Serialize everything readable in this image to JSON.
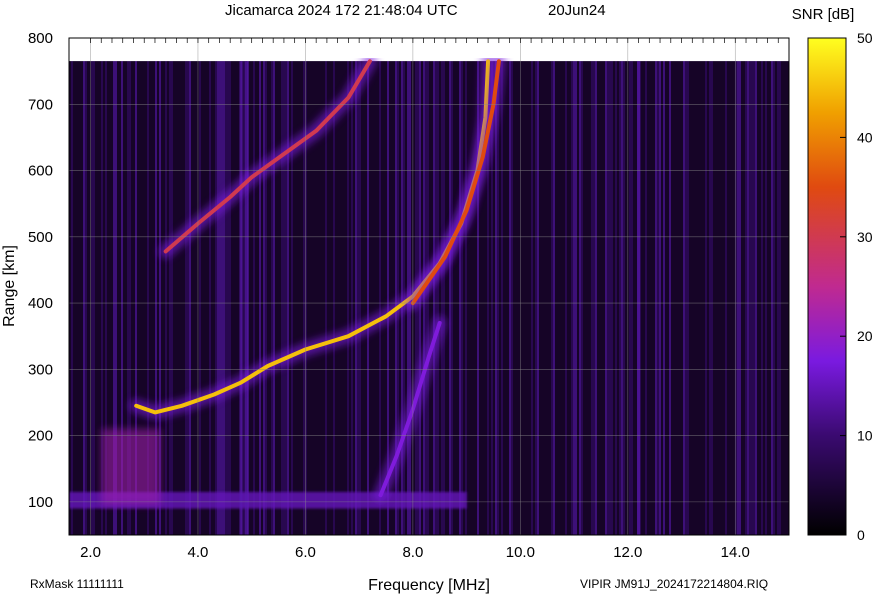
{
  "header": {
    "title": "Jicamarca 2024 172 21:48:04 UTC",
    "date": "20Jun24"
  },
  "footer": {
    "rxmask": "RxMask 11111111",
    "file": "VIPIR  JM91J_2024172214804.RIQ"
  },
  "chart_data": {
    "type": "heatmap",
    "title": "Jicamarca 2024 172 21:48:04 UTC",
    "xlabel": "Frequency [MHz]",
    "ylabel": "Range [km]",
    "colorbar_label": "SNR [dB]",
    "xlim": [
      1.6,
      15.0
    ],
    "ylim": [
      50,
      800
    ],
    "xticks": [
      2.0,
      4.0,
      6.0,
      8.0,
      10.0,
      12.0,
      14.0
    ],
    "xtick_labels": [
      "2.0",
      "4.0",
      "6.0",
      "8.0",
      "10.0",
      "12.0",
      "14.0"
    ],
    "yticks": [
      100,
      200,
      300,
      400,
      500,
      600,
      700,
      800
    ],
    "ytick_labels": [
      "100",
      "200",
      "300",
      "400",
      "500",
      "600",
      "700",
      "800"
    ],
    "colorbar_ticks": [
      0,
      10,
      20,
      30,
      40,
      50
    ],
    "colorbar_range": [
      0,
      50
    ],
    "colormap": [
      "#000000",
      "#3a0a70",
      "#7a1ae0",
      "#c02a90",
      "#e04a10",
      "#f0a000",
      "#ffff20"
    ],
    "grid": true,
    "data_top_range_km": 765,
    "traces": [
      {
        "name": "",
        "snr_db": 45,
        "points": [
          [
            2.85,
            245
          ],
          [
            3.2,
            235
          ],
          [
            3.7,
            245
          ],
          [
            4.3,
            262
          ],
          [
            4.8,
            280
          ],
          [
            5.3,
            305
          ],
          [
            6.0,
            330
          ],
          [
            6.8,
            350
          ],
          [
            7.5,
            380
          ],
          [
            8.0,
            410
          ],
          [
            8.5,
            460
          ],
          [
            8.9,
            520
          ],
          [
            9.2,
            600
          ],
          [
            9.35,
            680
          ],
          [
            9.4,
            765
          ]
        ]
      },
      {
        "name": "",
        "snr_db": 35,
        "points": [
          [
            8.0,
            400
          ],
          [
            8.6,
            470
          ],
          [
            9.0,
            540
          ],
          [
            9.3,
            620
          ],
          [
            9.5,
            700
          ],
          [
            9.6,
            765
          ]
        ]
      },
      {
        "name": "",
        "snr_db": 30,
        "points": [
          [
            3.4,
            478
          ],
          [
            4.0,
            520
          ],
          [
            4.6,
            560
          ],
          [
            5.0,
            590
          ],
          [
            5.6,
            625
          ],
          [
            6.2,
            660
          ],
          [
            6.8,
            710
          ],
          [
            7.2,
            765
          ]
        ]
      },
      {
        "name": "",
        "snr_db": 18,
        "points": [
          [
            7.4,
            110
          ],
          [
            7.7,
            170
          ],
          [
            8.0,
            240
          ],
          [
            8.3,
            320
          ],
          [
            8.5,
            370
          ]
        ]
      }
    ],
    "background_band": {
      "range_km": [
        90,
        115
      ],
      "freq_mhz": [
        1.6,
        9.0
      ],
      "snr_db": 15
    },
    "sporadic_patch": {
      "freq_mhz": [
        2.2,
        3.3
      ],
      "range_km": [
        95,
        210
      ],
      "snr_db": 22
    },
    "interference_lines_mhz": [
      4.8,
      4.9,
      12.2
    ]
  }
}
